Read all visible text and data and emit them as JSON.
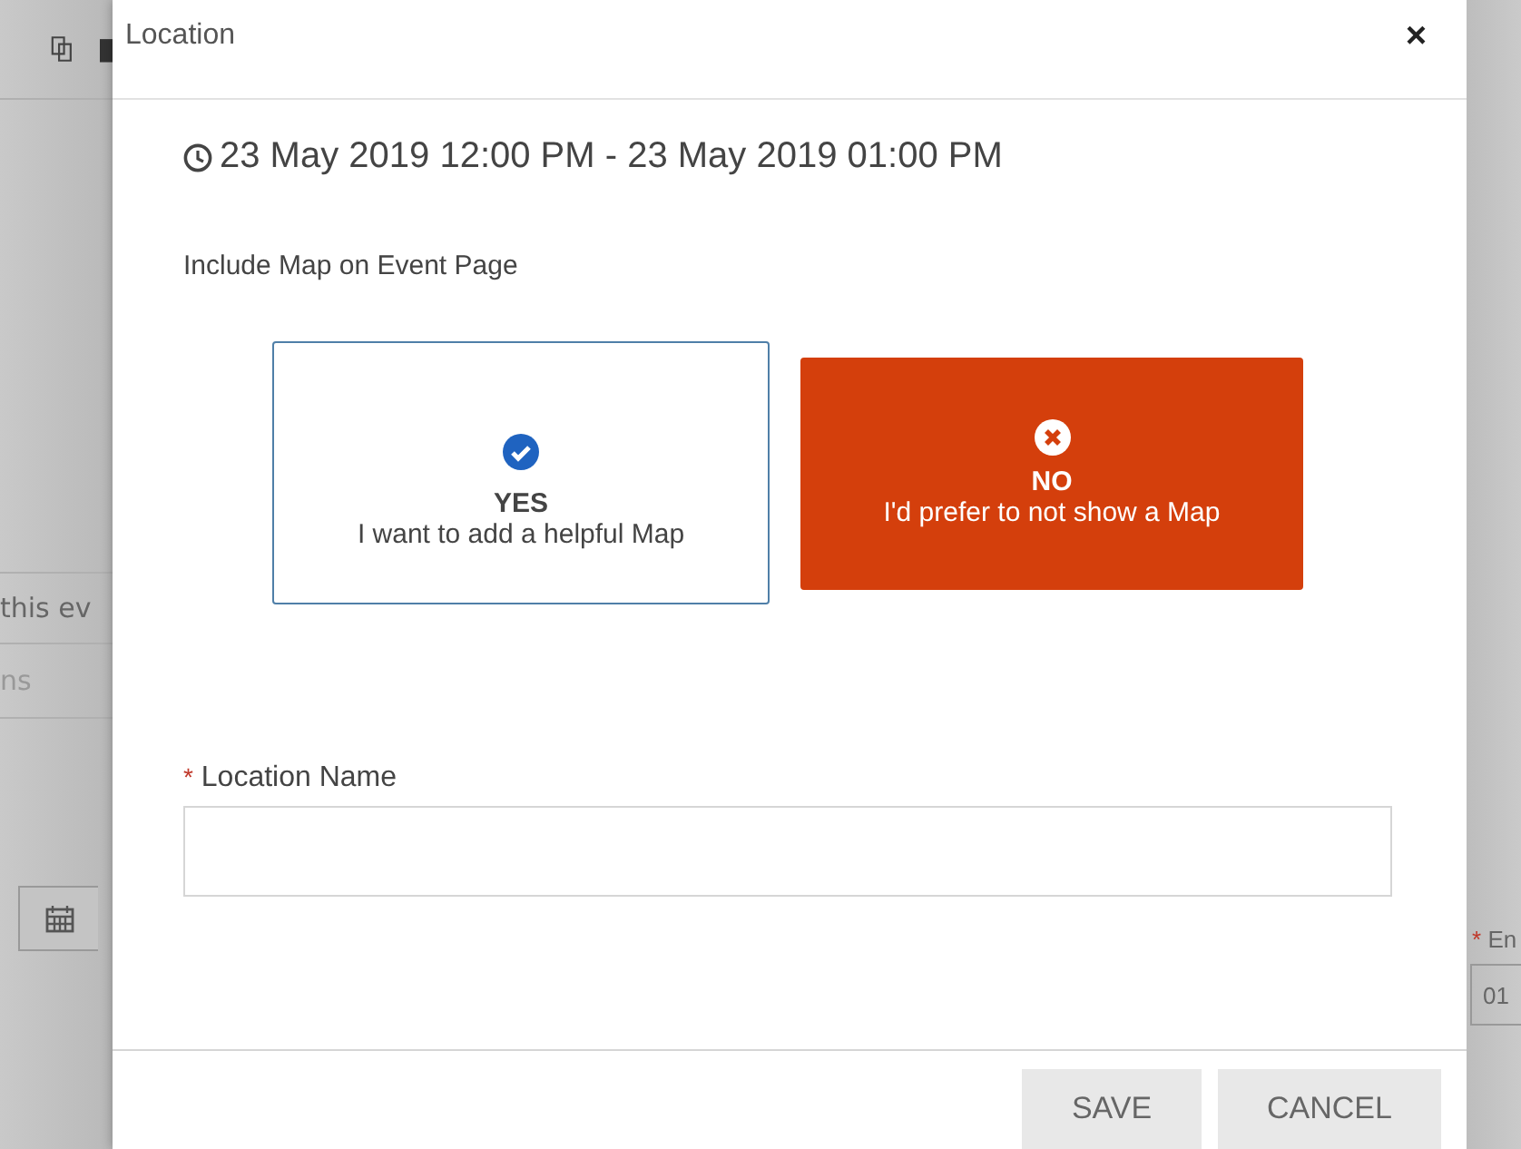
{
  "background": {
    "left_texts": [
      "this ev",
      "ns"
    ],
    "right_label": "En",
    "right_field_value": "01"
  },
  "dialog": {
    "title": "Location",
    "close": "×",
    "date_range": "23 May 2019 12:00 PM - 23 May 2019 01:00 PM",
    "map_label": "Include Map on Event Page",
    "options": [
      {
        "kind": "yes",
        "title": "YES",
        "subtitle": "I want to add a helpful Map",
        "selected": false
      },
      {
        "kind": "no",
        "title": "NO",
        "subtitle": "I'd prefer to not show a Map",
        "selected": true
      }
    ],
    "location_field": {
      "required_mark": "*",
      "label": "Location Name"
    },
    "buttons": [
      "SAVE",
      "CANCEL"
    ]
  }
}
